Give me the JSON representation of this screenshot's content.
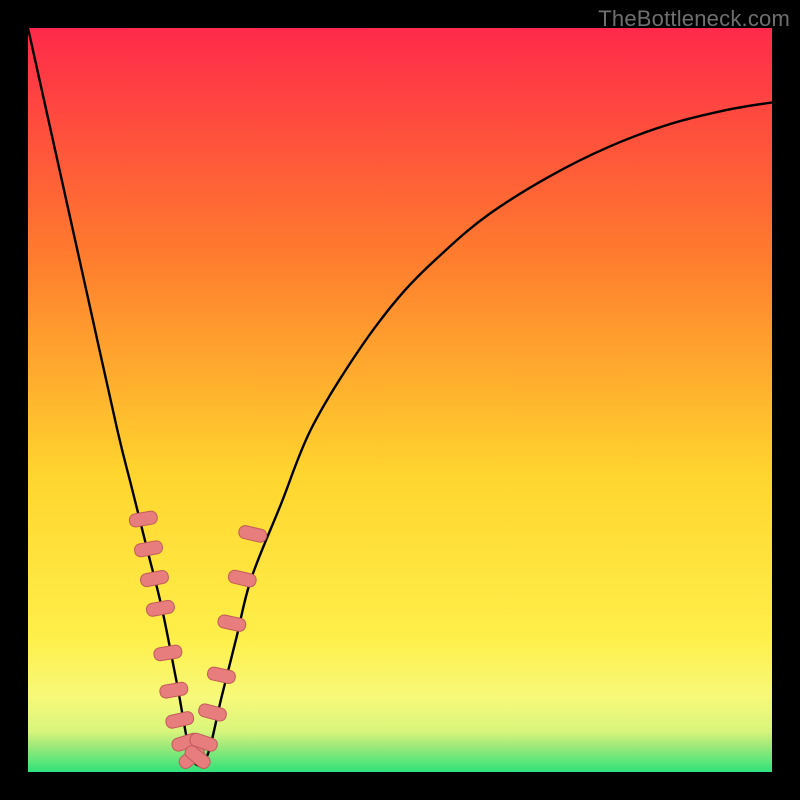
{
  "watermark": "TheBottleneck.com",
  "colors": {
    "gradient_top": "#ff2a4a",
    "gradient_mid1": "#ff7a2e",
    "gradient_mid2": "#ffd52e",
    "gradient_mid3": "#ffef4a",
    "gradient_bottom": "#2fe37a",
    "curve_stroke": "#000000",
    "marker_fill": "#e77d7d",
    "marker_stroke": "#c25b5b"
  },
  "chart_data": {
    "type": "line",
    "title": "",
    "xlabel": "",
    "ylabel": "",
    "x_range": [
      0,
      100
    ],
    "y_range": [
      0,
      100
    ],
    "curve": {
      "description": "bottleneck_pct vs component_index (V shape, minimum near x≈22)",
      "x": [
        0,
        4,
        8,
        12,
        14,
        16,
        18,
        20,
        22,
        24,
        26,
        28,
        30,
        34,
        38,
        44,
        50,
        56,
        62,
        70,
        78,
        86,
        94,
        100
      ],
      "y": [
        100,
        82,
        64,
        46,
        38,
        30,
        22,
        12,
        2,
        2,
        10,
        18,
        26,
        36,
        46,
        56,
        64,
        70,
        75,
        80,
        84,
        87,
        89,
        90
      ]
    },
    "markers": [
      {
        "x": 15.5,
        "y": 34
      },
      {
        "x": 16.2,
        "y": 30
      },
      {
        "x": 17.0,
        "y": 26
      },
      {
        "x": 17.8,
        "y": 22
      },
      {
        "x": 18.8,
        "y": 16
      },
      {
        "x": 19.6,
        "y": 11
      },
      {
        "x": 20.4,
        "y": 7
      },
      {
        "x": 21.2,
        "y": 4
      },
      {
        "x": 22.0,
        "y": 2
      },
      {
        "x": 22.8,
        "y": 2
      },
      {
        "x": 23.6,
        "y": 4
      },
      {
        "x": 24.8,
        "y": 8
      },
      {
        "x": 26.0,
        "y": 13
      },
      {
        "x": 27.4,
        "y": 20
      },
      {
        "x": 28.8,
        "y": 26
      },
      {
        "x": 30.2,
        "y": 32
      }
    ]
  }
}
